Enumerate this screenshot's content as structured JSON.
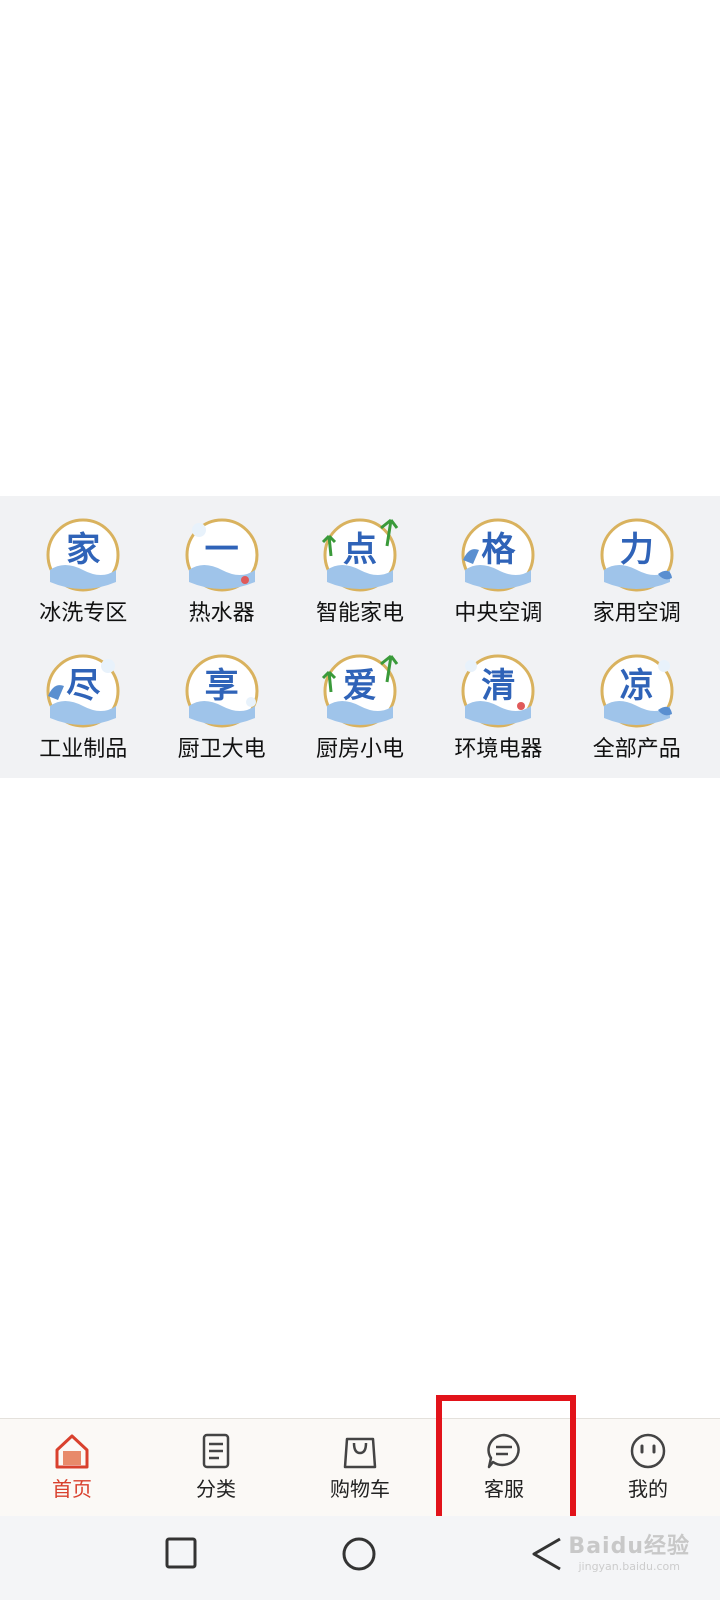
{
  "categories": [
    {
      "glyph": "家",
      "label": "冰洗专区"
    },
    {
      "glyph": "一",
      "label": "热水器"
    },
    {
      "glyph": "点",
      "label": "智能家电"
    },
    {
      "glyph": "格",
      "label": "中央空调"
    },
    {
      "glyph": "力",
      "label": "家用空调"
    },
    {
      "glyph": "尽",
      "label": "工业制品"
    },
    {
      "glyph": "享",
      "label": "厨卫大电"
    },
    {
      "glyph": "爱",
      "label": "厨房小电"
    },
    {
      "glyph": "清",
      "label": "环境电器"
    },
    {
      "glyph": "凉",
      "label": "全部产品"
    }
  ],
  "tabbar": {
    "active": "首页",
    "items": [
      {
        "icon": "home-icon",
        "label": "首页"
      },
      {
        "icon": "list-icon",
        "label": "分类"
      },
      {
        "icon": "shopping-bag-icon",
        "label": "购物车"
      },
      {
        "icon": "chat-bubble-icon",
        "label": "客服"
      },
      {
        "icon": "face-icon",
        "label": "我的"
      }
    ]
  },
  "system_nav": {
    "buttons": [
      "recent-apps-icon",
      "home-circle-icon",
      "back-triangle-icon"
    ]
  },
  "watermark": {
    "text": "Baidu经验",
    "url": "jingyan.baidu.com"
  },
  "colors": {
    "accent": "#d9412e",
    "highlight_box": "#e2131a",
    "icon_blue": "#2f63b8",
    "ring_gold": "#d9b25e"
  }
}
